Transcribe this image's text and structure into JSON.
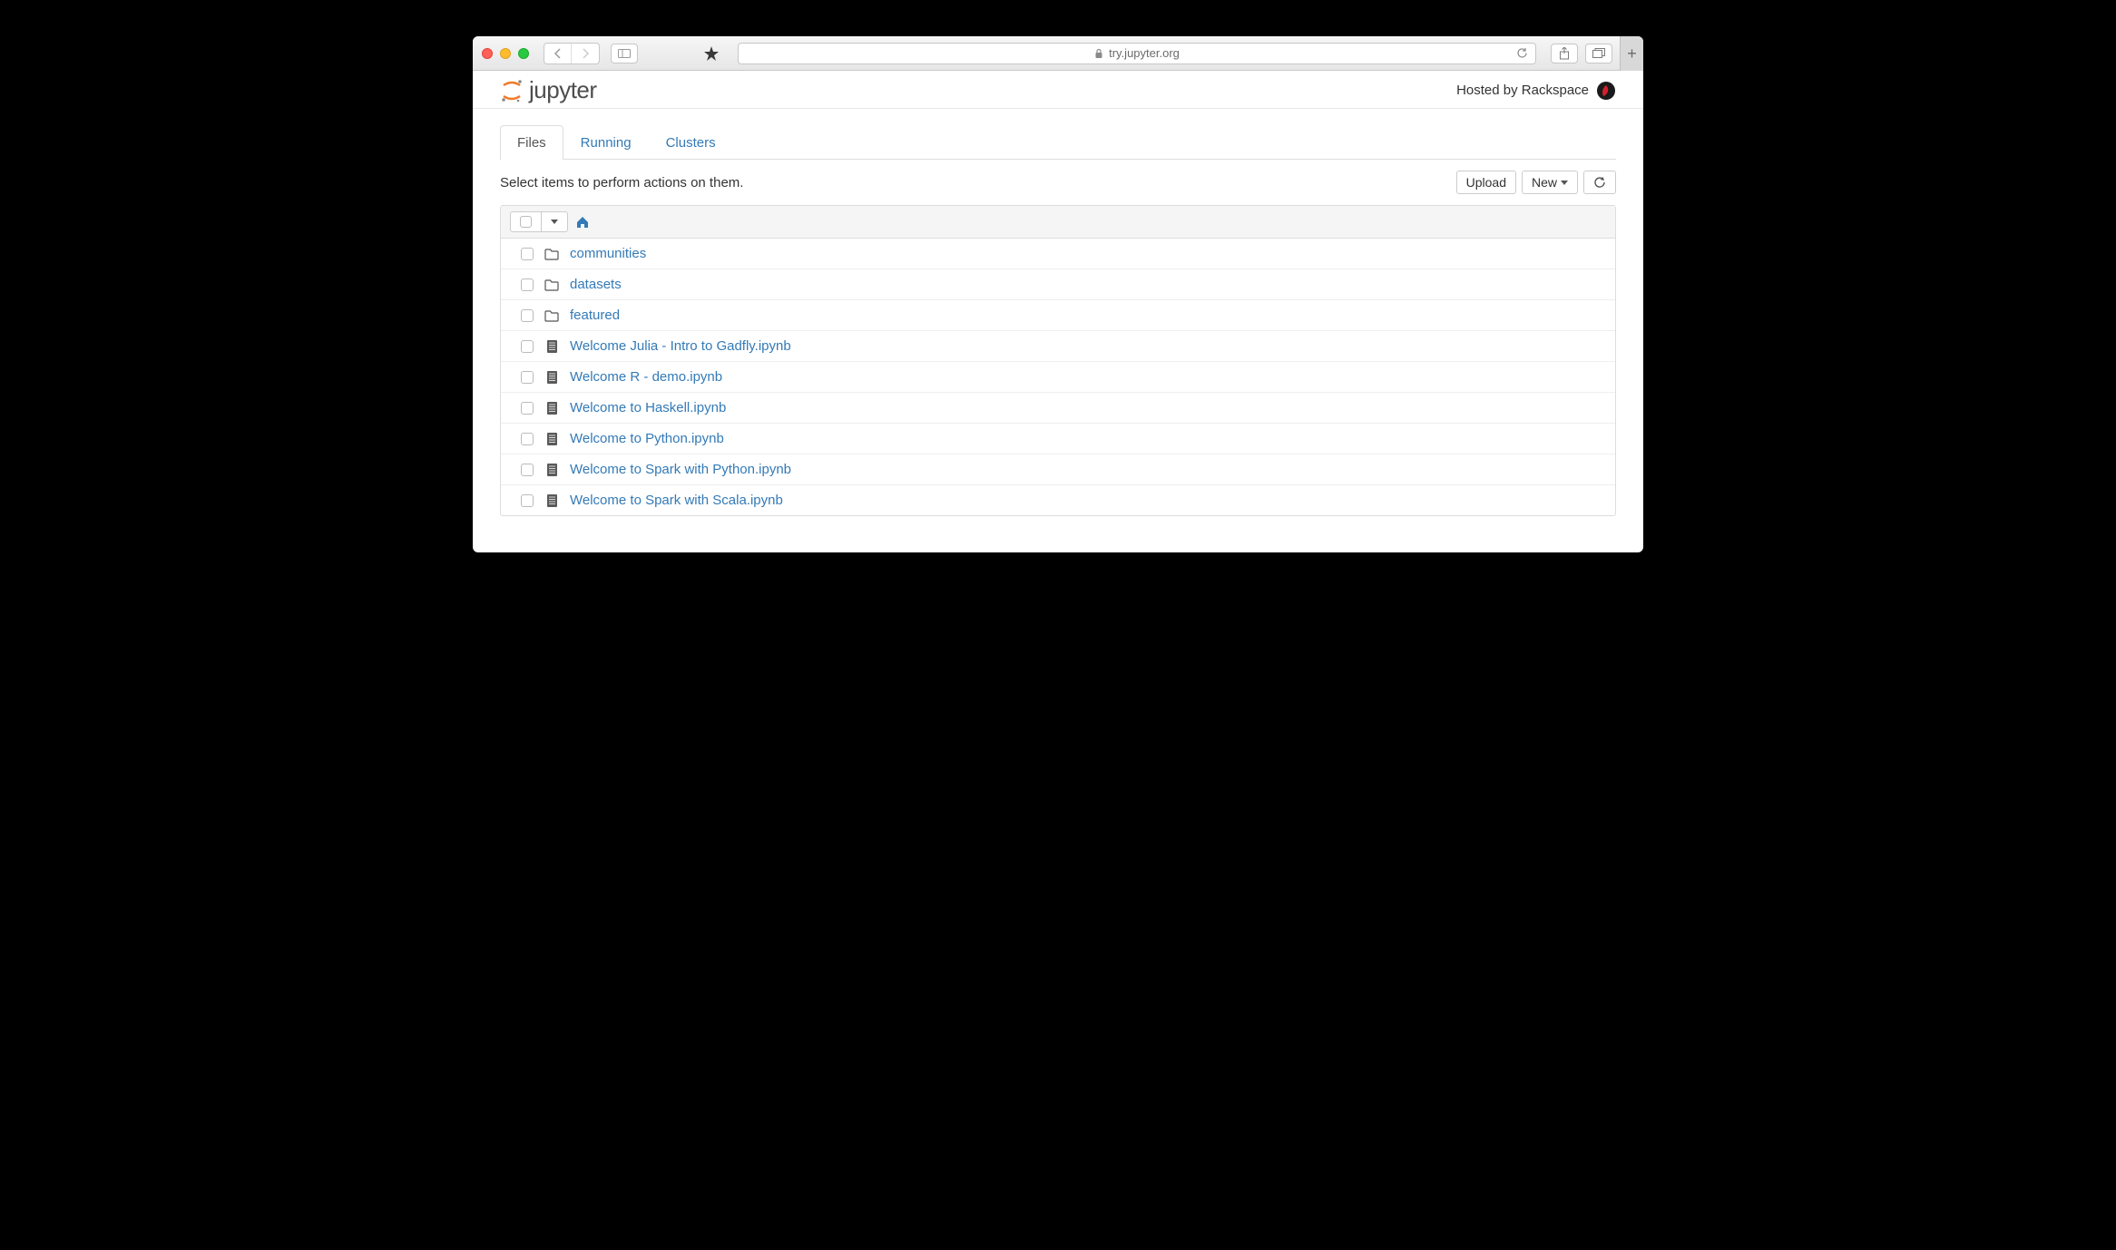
{
  "browser": {
    "url": "try.jupyter.org"
  },
  "header": {
    "logo_text": "jupyter",
    "hosted_by": "Hosted by Rackspace"
  },
  "tabs": [
    {
      "label": "Files",
      "active": true
    },
    {
      "label": "Running",
      "active": false
    },
    {
      "label": "Clusters",
      "active": false
    }
  ],
  "toolbar": {
    "hint": "Select items to perform actions on them.",
    "upload_label": "Upload",
    "new_label": "New"
  },
  "files": [
    {
      "type": "folder",
      "name": "communities"
    },
    {
      "type": "folder",
      "name": "datasets"
    },
    {
      "type": "folder",
      "name": "featured"
    },
    {
      "type": "notebook",
      "name": "Welcome Julia - Intro to Gadfly.ipynb"
    },
    {
      "type": "notebook",
      "name": "Welcome R - demo.ipynb"
    },
    {
      "type": "notebook",
      "name": "Welcome to Haskell.ipynb"
    },
    {
      "type": "notebook",
      "name": "Welcome to Python.ipynb"
    },
    {
      "type": "notebook",
      "name": "Welcome to Spark with Python.ipynb"
    },
    {
      "type": "notebook",
      "name": "Welcome to Spark with Scala.ipynb"
    }
  ]
}
